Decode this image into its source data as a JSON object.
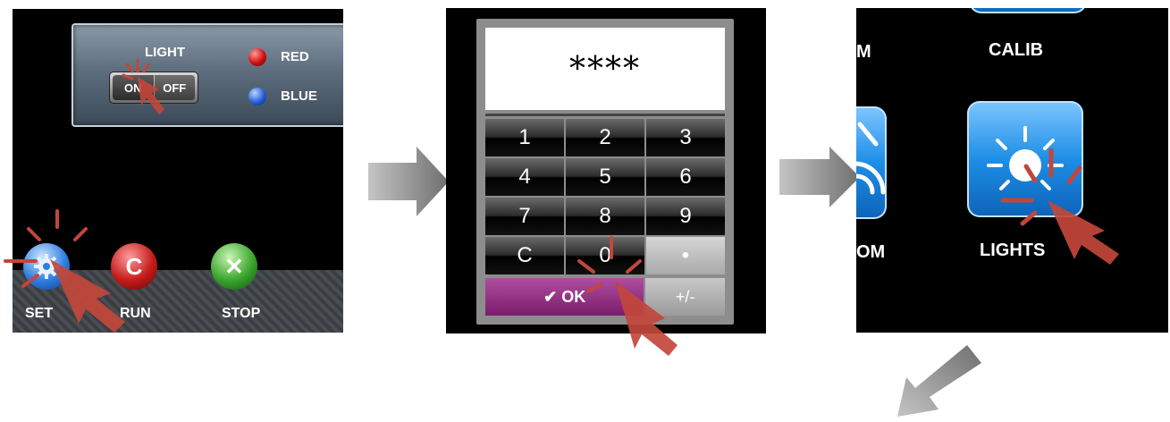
{
  "panel1": {
    "light_label": "LIGHT",
    "toggle": {
      "on": "ON",
      "off": "OFF"
    },
    "indicators": [
      {
        "label": "RED",
        "color": "#d10f10"
      },
      {
        "label": "BLUE",
        "color": "#2460d8"
      }
    ],
    "buttons": [
      {
        "label": "SET",
        "icon": "gear-icon"
      },
      {
        "label": "RUN",
        "icon": "refresh-icon"
      },
      {
        "label": "STOP",
        "icon": "close-icon"
      }
    ]
  },
  "panel2": {
    "display": "****",
    "keys": [
      "1",
      "2",
      "3",
      "4",
      "5",
      "6",
      "7",
      "8",
      "9",
      "C",
      "0",
      "•"
    ],
    "ok_label": "✔ OK",
    "plusminus_label": "+/-"
  },
  "panel3": {
    "labels": {
      "top_left": "M",
      "calib": "CALIB",
      "mid_left": "OM",
      "lights": "LIGHTS"
    }
  },
  "colors": {
    "tap_indicator": "#c2463b",
    "flow_arrow": "#777777",
    "ok_purple": "#8b2a7c"
  }
}
